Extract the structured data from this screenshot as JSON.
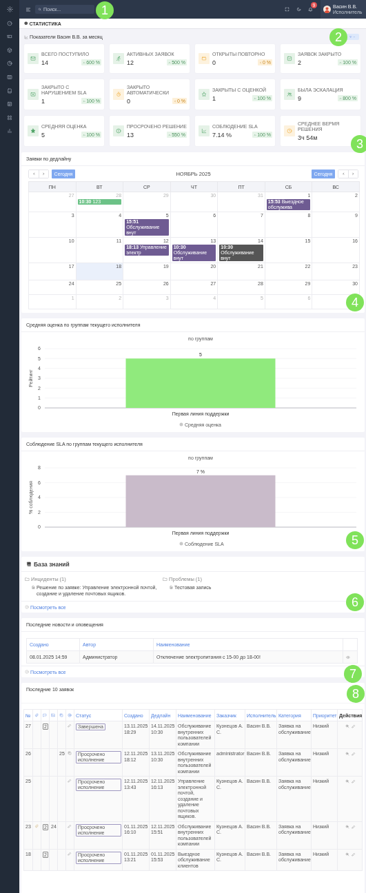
{
  "header": {
    "search": {
      "placeholder": "Поиск..."
    },
    "notifications": {
      "count": "9"
    },
    "user": {
      "name": "Васин В.В.",
      "role": "Исполнитель"
    }
  },
  "breadcrumb": {
    "title": "СТАТИСТИКА"
  },
  "stats": {
    "title": "Показатели Васин В.В. за месяц",
    "cards": [
      {
        "label": "ВСЕГО ПОСТУПИЛО",
        "value": "14",
        "change": "600 %",
        "up": true
      },
      {
        "label": "АКТИВНЫХ ЗАЯВОК",
        "value": "12",
        "change": "500 %",
        "up": true
      },
      {
        "label": "ОТКРЫТЫ ПОВТОРНО",
        "value": "0",
        "change": "0 %",
        "up": false
      },
      {
        "label": "ЗАЯВОК ЗАКРЫТО",
        "value": "2",
        "change": "100 %",
        "up": true
      },
      {
        "label": "ЗАКРЫТО С НАРУШЕНИЕМ SLA",
        "value": "1",
        "change": "100 %",
        "up": true
      },
      {
        "label": "ЗАКРЫТО АВТОМАТИЧЕСКИ",
        "value": "0",
        "change": "0 %",
        "up": false
      },
      {
        "label": "ЗАКРЫТЫ С ОЦЕНКОЙ",
        "value": "1",
        "change": "100 %",
        "up": true
      },
      {
        "label": "БЫЛА ЭСКАЛАЦИЯ",
        "value": "9",
        "change": "800 %",
        "up": true
      },
      {
        "label": "СРЕДНЯЯ ОЦЕНКА",
        "value": "5",
        "change": "100 %",
        "up": true
      },
      {
        "label": "ПРОСРОЧЕНО РЕШЕНИЕ",
        "value": "13",
        "change": "550 %",
        "up": true
      },
      {
        "label": "СОБЛЮДЕНИЕ SLA",
        "value": "7.14 %",
        "change": "100 %",
        "up": true
      },
      {
        "label": "СРЕДНЕЕ ВЕРМЯ РЕШЕНИЯ",
        "value": "3ч 54м",
        "up": false
      }
    ]
  },
  "calendar": {
    "title": "Заявки по дедлайну",
    "month": "НОЯБРЬ 2025",
    "today_button_left": "Сегодня",
    "today_button_right": "Сегодня",
    "weekdays": [
      "ПН",
      "ВТ",
      "СР",
      "ЧТ",
      "ПТ",
      "СБ",
      "ВС"
    ],
    "weeks": [
      {
        "days": [
          {
            "date": "27",
            "other_month": true,
            "today": false
          },
          {
            "date": "28",
            "other_month": true,
            "today": false,
            "events": [
              {
                "time": "10:30",
                "title": "123",
                "color": "#6cc287"
              }
            ]
          },
          {
            "date": "29",
            "other_month": true,
            "today": false
          },
          {
            "date": "30",
            "other_month": true,
            "today": false
          },
          {
            "date": "31",
            "other_month": true,
            "today": false
          },
          {
            "date": "1",
            "other_month": false,
            "today": false,
            "events": [
              {
                "time": "15:53",
                "title": "Выездное обслужива",
                "color": "#6e5b92"
              }
            ]
          },
          {
            "date": "2",
            "other_month": false,
            "today": false
          }
        ]
      },
      {
        "days": [
          {
            "date": "3",
            "other_month": false,
            "today": false
          },
          {
            "date": "4",
            "other_month": false,
            "today": false
          },
          {
            "date": "5",
            "other_month": false,
            "today": false,
            "events": [
              {
                "time": "15:51",
                "title": "Обслуживание внут",
                "color": "#6e5b92"
              }
            ]
          },
          {
            "date": "6",
            "other_month": false,
            "today": false
          },
          {
            "date": "7",
            "other_month": false,
            "today": false
          },
          {
            "date": "8",
            "other_month": false,
            "today": false
          },
          {
            "date": "9",
            "other_month": false,
            "today": false
          }
        ]
      },
      {
        "days": [
          {
            "date": "10",
            "other_month": false,
            "today": false
          },
          {
            "date": "11",
            "other_month": false,
            "today": false
          },
          {
            "date": "12",
            "other_month": false,
            "today": false,
            "events": [
              {
                "time": "18:13",
                "title": "Управление электр",
                "color": "#6e5b92"
              }
            ]
          },
          {
            "date": "13",
            "other_month": false,
            "today": false,
            "events": [
              {
                "time": "10:30",
                "title": "Обслуживание внут",
                "color": "#6e5b92"
              }
            ]
          },
          {
            "date": "14",
            "other_month": false,
            "today": false,
            "events": [
              {
                "time": "10:30",
                "title": "Обслуживание внут",
                "color": "#555555"
              }
            ]
          },
          {
            "date": "15",
            "other_month": false,
            "today": false
          },
          {
            "date": "16",
            "other_month": false,
            "today": false
          }
        ]
      },
      {
        "days": [
          {
            "date": "17",
            "other_month": false,
            "today": false
          },
          {
            "date": "18",
            "other_month": false,
            "today": true
          },
          {
            "date": "19",
            "other_month": false,
            "today": false
          },
          {
            "date": "20",
            "other_month": false,
            "today": false
          },
          {
            "date": "21",
            "other_month": false,
            "today": false
          },
          {
            "date": "22",
            "other_month": false,
            "today": false
          },
          {
            "date": "23",
            "other_month": false,
            "today": false
          }
        ]
      },
      {
        "days": [
          {
            "date": "24",
            "other_month": false,
            "today": false
          },
          {
            "date": "25",
            "other_month": false,
            "today": false
          },
          {
            "date": "26",
            "other_month": false,
            "today": false
          },
          {
            "date": "27",
            "other_month": false,
            "today": false
          },
          {
            "date": "28",
            "other_month": false,
            "today": false
          },
          {
            "date": "29",
            "other_month": false,
            "today": false
          },
          {
            "date": "30",
            "other_month": false,
            "today": false
          }
        ]
      },
      {
        "days": [
          {
            "date": "1",
            "other_month": true,
            "today": false
          },
          {
            "date": "2",
            "other_month": true,
            "today": false
          },
          {
            "date": "3",
            "other_month": true,
            "today": false
          },
          {
            "date": "4",
            "other_month": true,
            "today": false
          },
          {
            "date": "5",
            "other_month": true,
            "today": false
          },
          {
            "date": "6",
            "other_month": true,
            "today": false
          },
          {
            "today": false
          }
        ]
      }
    ]
  },
  "charts": [
    {
      "title": "Средняя оценка по группам текущего исполнителя",
      "chart_data": {
        "type": "bar",
        "title": "по группам",
        "ylabel": "Рейтинг",
        "categories": [
          "Первая линия поддержки"
        ],
        "series": [
          {
            "name": "Средняя оценка",
            "color": "#90ea7d",
            "values": [
              5
            ]
          }
        ],
        "ylim": [
          0,
          6
        ],
        "yticks": [
          0,
          1,
          2,
          3,
          4,
          5,
          6
        ],
        "grid": true,
        "value_labels": [
          "5"
        ]
      }
    },
    {
      "title": "Соблюдение SLA по группам текущего исполнителя",
      "chart_data": {
        "type": "bar",
        "title": "по группам",
        "ylabel": "% соблюдения",
        "categories": [
          "Первая линия поддержки"
        ],
        "series": [
          {
            "name": "Соблюдение SLA",
            "color": "#c9bbca",
            "values": [
              7
            ]
          }
        ],
        "ylim": [
          0,
          8
        ],
        "yticks": [
          0,
          2,
          4,
          6,
          8
        ],
        "grid": true,
        "value_labels": [
          "7 %"
        ]
      }
    }
  ],
  "knowledge_base": {
    "title": "База знаний",
    "view_all": "Посмотреть все",
    "folders": [
      {
        "name": "Инциденты (1)",
        "items": [
          "Решение по заявке: Управление электронной почтой, создание и удаление почтовых ящиков."
        ]
      },
      {
        "name": "Проблемы (1)",
        "items": [
          "Тестовая запись"
        ]
      }
    ]
  },
  "news": {
    "title": "Последние новости и оповещения",
    "view_all": "Посмотреть все",
    "columns": [
      "Создано",
      "Автор",
      "Наименование"
    ],
    "rows": [
      [
        "08.01.2025 14:59",
        "Администратор",
        "Отключение электропитания с 15-00 до 18-00!"
      ]
    ]
  },
  "requests": {
    "title": "Последние 10 заявок",
    "columns": [
      {
        "kind": "text",
        "label": "№",
        "sortable": true
      },
      {
        "kind": "icon",
        "sortable": true
      },
      {
        "kind": "icon",
        "sortable": true
      },
      {
        "kind": "icon",
        "sortable": true
      },
      {
        "kind": "icon",
        "sortable": true
      },
      {
        "kind": "icon",
        "sortable": true
      },
      {
        "kind": "text",
        "label": "Статус",
        "sortable": true
      },
      {
        "kind": "text",
        "label": "Создано",
        "sortable": true
      },
      {
        "kind": "text",
        "label": "Дедлайн",
        "sortable": true
      },
      {
        "kind": "text",
        "label": "Наименование",
        "sortable": true
      },
      {
        "kind": "text",
        "label": "Заказчик",
        "sortable": true
      },
      {
        "kind": "text",
        "label": "Исполнитель",
        "sortable": true
      },
      {
        "kind": "text",
        "label": "Категория",
        "sortable": true
      },
      {
        "kind": "text",
        "label": "Приоритет",
        "sortable": true
      },
      {
        "kind": "text",
        "label": "Действия",
        "sortable": false
      }
    ],
    "rows": [
      {
        "number": "27",
        "attachment": false,
        "comments": "2",
        "copied": false,
        "status": "Завершена",
        "created": "13.11.2025 18:29",
        "deadline": "14.11.2025 10:30",
        "name": "Обслуживание внутренних пользователей компании",
        "customer": "Кузнецов А. С.",
        "executor": "Васин В.В.",
        "category": "Заявка на обслуживание",
        "priority": "Низкий"
      },
      {
        "number": "26",
        "attachment": false,
        "column_5": "25",
        "copied": true,
        "status": "Просрочено исполнение",
        "created": "12.11.2025 18:12",
        "deadline": "13.11.2025 10:30",
        "name": "Обслуживание внутренних пользователей компании",
        "customer": "administrator",
        "executor": "Васин В.В.",
        "category": "Заявка на обслуживание",
        "priority": "Низкий"
      },
      {
        "number": "25",
        "attachment": false,
        "copied": false,
        "status": "Просрочено исполнение",
        "created": "12.11.2025 13:43",
        "deadline": "12.11.2025 16:13",
        "name": "Управление электронной почтой, создание и удаление почтовых ящиков.",
        "customer": "Кузнецов А. С.",
        "executor": "Васин В.В.",
        "category": "Заявка на обслуживание",
        "priority": "Низкий"
      },
      {
        "number": "23",
        "attachment": true,
        "comments": "2",
        "column_4": "24",
        "copied": false,
        "status": "Просрочено исполнение",
        "created": "01.11.2025 16:10",
        "deadline": "12.11.2025 15:51",
        "name": "Обслуживание внутренних пользователей компании",
        "customer": "Кузнецов А. С.",
        "executor": "Васин В.В.",
        "category": "Заявка на обслуживание",
        "priority": "Низкий"
      },
      {
        "number": "18",
        "attachment": false,
        "comments": "2",
        "copied": false,
        "status": "Просрочено исполнение",
        "created": "01.11.2025 13:21",
        "deadline": "01.11.2025 15:53",
        "name": "Выездное обслуживание клиентов",
        "customer": "Кузнецов А. С.",
        "executor": "Васин В.В.",
        "category": "Заявка на обслуживание",
        "priority": "Низкий"
      }
    ]
  },
  "step_markers": [
    "1",
    "2",
    "3",
    "4",
    "5",
    "6",
    "7",
    "8"
  ]
}
